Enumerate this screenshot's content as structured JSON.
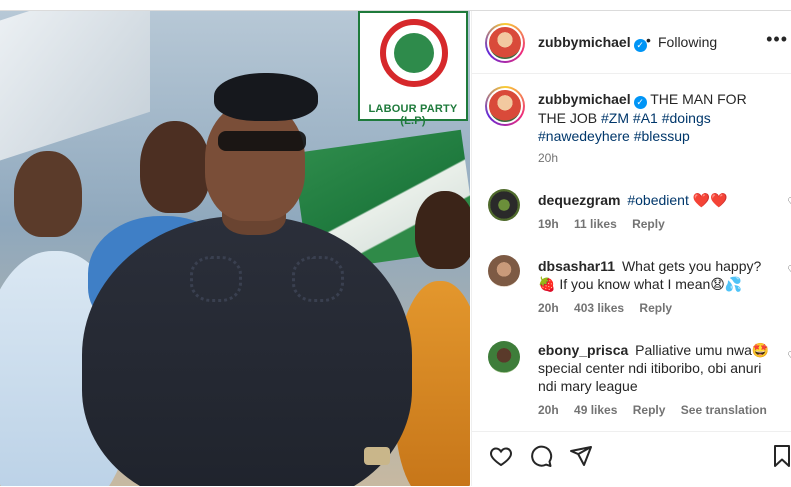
{
  "post": {
    "username": "zubbymichael",
    "follow_separator": "•",
    "follow_status": "Following",
    "more_icon": "more-options-icon",
    "logo_text": "LABOUR PARTY (L.P)",
    "caption": {
      "username": "zubbymichael",
      "text": "THE MAN FOR THE JOB",
      "tags": "#ZM #A1 #doings #nawedeyhere #blessup",
      "time": "20h"
    }
  },
  "comments": [
    {
      "username": "dequezgram",
      "text": "#obedient",
      "emoji": "❤️❤️",
      "time": "19h",
      "likes": "11 likes",
      "reply": "Reply",
      "extra": ""
    },
    {
      "username": "dbsashar11",
      "text": "What gets you happy? 🍓 If you know what I mean😧💦",
      "emoji": "",
      "time": "20h",
      "likes": "403 likes",
      "reply": "Reply",
      "extra": ""
    },
    {
      "username": "ebony_prisca",
      "text": "Palliative umu nwa🤩 special center ndi itiboribo, obi anuri ndi mary league",
      "emoji": "",
      "time": "20h",
      "likes": "49 likes",
      "reply": "Reply",
      "extra": "See translation"
    }
  ],
  "colors": {
    "link": "#00376b",
    "verified": "#0095f6",
    "muted": "#737373"
  }
}
